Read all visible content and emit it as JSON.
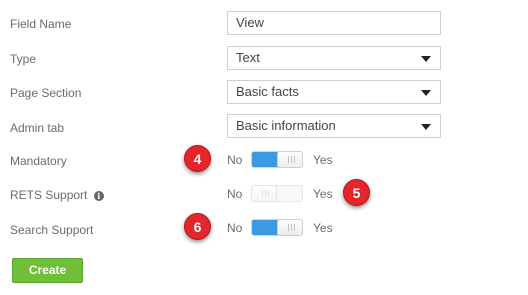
{
  "form": {
    "field_name": {
      "label": "Field Name",
      "value": "View"
    },
    "type": {
      "label": "Type",
      "value": "Text"
    },
    "page_section": {
      "label": "Page Section",
      "value": "Basic facts"
    },
    "admin_tab": {
      "label": "Admin tab",
      "value": "Basic information"
    },
    "mandatory": {
      "label": "Mandatory",
      "no": "No",
      "yes": "Yes",
      "state": "yes"
    },
    "rets_support": {
      "label": "RETS Support",
      "info_icon": "info-icon",
      "no": "No",
      "yes": "Yes",
      "state": "no"
    },
    "search_support": {
      "label": "Search Support",
      "no": "No",
      "yes": "Yes",
      "state": "yes"
    },
    "create_label": "Create"
  },
  "annotations": {
    "badge_4": "4",
    "badge_5": "5",
    "badge_6": "6"
  },
  "colors": {
    "toggle_on": "#3a9ae6",
    "badge": "#e2262a",
    "create_button": "#6fbf3b"
  }
}
